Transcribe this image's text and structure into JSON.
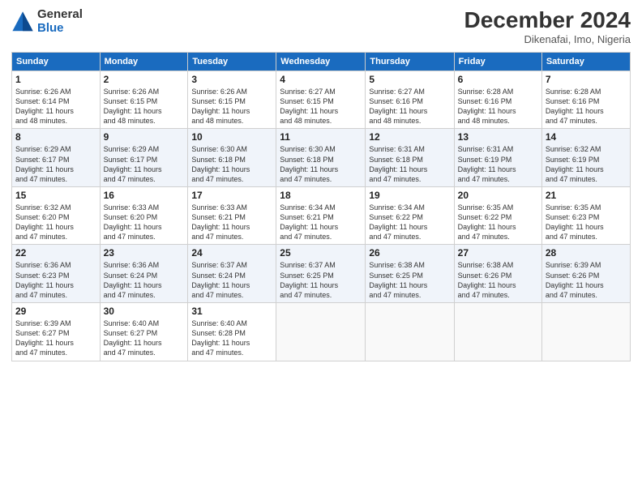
{
  "header": {
    "logo_general": "General",
    "logo_blue": "Blue",
    "month_title": "December 2024",
    "location": "Dikenafai, Imo, Nigeria"
  },
  "days_of_week": [
    "Sunday",
    "Monday",
    "Tuesday",
    "Wednesday",
    "Thursday",
    "Friday",
    "Saturday"
  ],
  "weeks": [
    [
      {
        "day": "1",
        "info": "Sunrise: 6:26 AM\nSunset: 6:14 PM\nDaylight: 11 hours\nand 48 minutes."
      },
      {
        "day": "2",
        "info": "Sunrise: 6:26 AM\nSunset: 6:15 PM\nDaylight: 11 hours\nand 48 minutes."
      },
      {
        "day": "3",
        "info": "Sunrise: 6:26 AM\nSunset: 6:15 PM\nDaylight: 11 hours\nand 48 minutes."
      },
      {
        "day": "4",
        "info": "Sunrise: 6:27 AM\nSunset: 6:15 PM\nDaylight: 11 hours\nand 48 minutes."
      },
      {
        "day": "5",
        "info": "Sunrise: 6:27 AM\nSunset: 6:16 PM\nDaylight: 11 hours\nand 48 minutes."
      },
      {
        "day": "6",
        "info": "Sunrise: 6:28 AM\nSunset: 6:16 PM\nDaylight: 11 hours\nand 48 minutes."
      },
      {
        "day": "7",
        "info": "Sunrise: 6:28 AM\nSunset: 6:16 PM\nDaylight: 11 hours\nand 47 minutes."
      }
    ],
    [
      {
        "day": "8",
        "info": "Sunrise: 6:29 AM\nSunset: 6:17 PM\nDaylight: 11 hours\nand 47 minutes."
      },
      {
        "day": "9",
        "info": "Sunrise: 6:29 AM\nSunset: 6:17 PM\nDaylight: 11 hours\nand 47 minutes."
      },
      {
        "day": "10",
        "info": "Sunrise: 6:30 AM\nSunset: 6:18 PM\nDaylight: 11 hours\nand 47 minutes."
      },
      {
        "day": "11",
        "info": "Sunrise: 6:30 AM\nSunset: 6:18 PM\nDaylight: 11 hours\nand 47 minutes."
      },
      {
        "day": "12",
        "info": "Sunrise: 6:31 AM\nSunset: 6:18 PM\nDaylight: 11 hours\nand 47 minutes."
      },
      {
        "day": "13",
        "info": "Sunrise: 6:31 AM\nSunset: 6:19 PM\nDaylight: 11 hours\nand 47 minutes."
      },
      {
        "day": "14",
        "info": "Sunrise: 6:32 AM\nSunset: 6:19 PM\nDaylight: 11 hours\nand 47 minutes."
      }
    ],
    [
      {
        "day": "15",
        "info": "Sunrise: 6:32 AM\nSunset: 6:20 PM\nDaylight: 11 hours\nand 47 minutes."
      },
      {
        "day": "16",
        "info": "Sunrise: 6:33 AM\nSunset: 6:20 PM\nDaylight: 11 hours\nand 47 minutes."
      },
      {
        "day": "17",
        "info": "Sunrise: 6:33 AM\nSunset: 6:21 PM\nDaylight: 11 hours\nand 47 minutes."
      },
      {
        "day": "18",
        "info": "Sunrise: 6:34 AM\nSunset: 6:21 PM\nDaylight: 11 hours\nand 47 minutes."
      },
      {
        "day": "19",
        "info": "Sunrise: 6:34 AM\nSunset: 6:22 PM\nDaylight: 11 hours\nand 47 minutes."
      },
      {
        "day": "20",
        "info": "Sunrise: 6:35 AM\nSunset: 6:22 PM\nDaylight: 11 hours\nand 47 minutes."
      },
      {
        "day": "21",
        "info": "Sunrise: 6:35 AM\nSunset: 6:23 PM\nDaylight: 11 hours\nand 47 minutes."
      }
    ],
    [
      {
        "day": "22",
        "info": "Sunrise: 6:36 AM\nSunset: 6:23 PM\nDaylight: 11 hours\nand 47 minutes."
      },
      {
        "day": "23",
        "info": "Sunrise: 6:36 AM\nSunset: 6:24 PM\nDaylight: 11 hours\nand 47 minutes."
      },
      {
        "day": "24",
        "info": "Sunrise: 6:37 AM\nSunset: 6:24 PM\nDaylight: 11 hours\nand 47 minutes."
      },
      {
        "day": "25",
        "info": "Sunrise: 6:37 AM\nSunset: 6:25 PM\nDaylight: 11 hours\nand 47 minutes."
      },
      {
        "day": "26",
        "info": "Sunrise: 6:38 AM\nSunset: 6:25 PM\nDaylight: 11 hours\nand 47 minutes."
      },
      {
        "day": "27",
        "info": "Sunrise: 6:38 AM\nSunset: 6:26 PM\nDaylight: 11 hours\nand 47 minutes."
      },
      {
        "day": "28",
        "info": "Sunrise: 6:39 AM\nSunset: 6:26 PM\nDaylight: 11 hours\nand 47 minutes."
      }
    ],
    [
      {
        "day": "29",
        "info": "Sunrise: 6:39 AM\nSunset: 6:27 PM\nDaylight: 11 hours\nand 47 minutes."
      },
      {
        "day": "30",
        "info": "Sunrise: 6:40 AM\nSunset: 6:27 PM\nDaylight: 11 hours\nand 47 minutes."
      },
      {
        "day": "31",
        "info": "Sunrise: 6:40 AM\nSunset: 6:28 PM\nDaylight: 11 hours\nand 47 minutes."
      },
      {
        "day": "",
        "info": ""
      },
      {
        "day": "",
        "info": ""
      },
      {
        "day": "",
        "info": ""
      },
      {
        "day": "",
        "info": ""
      }
    ]
  ]
}
